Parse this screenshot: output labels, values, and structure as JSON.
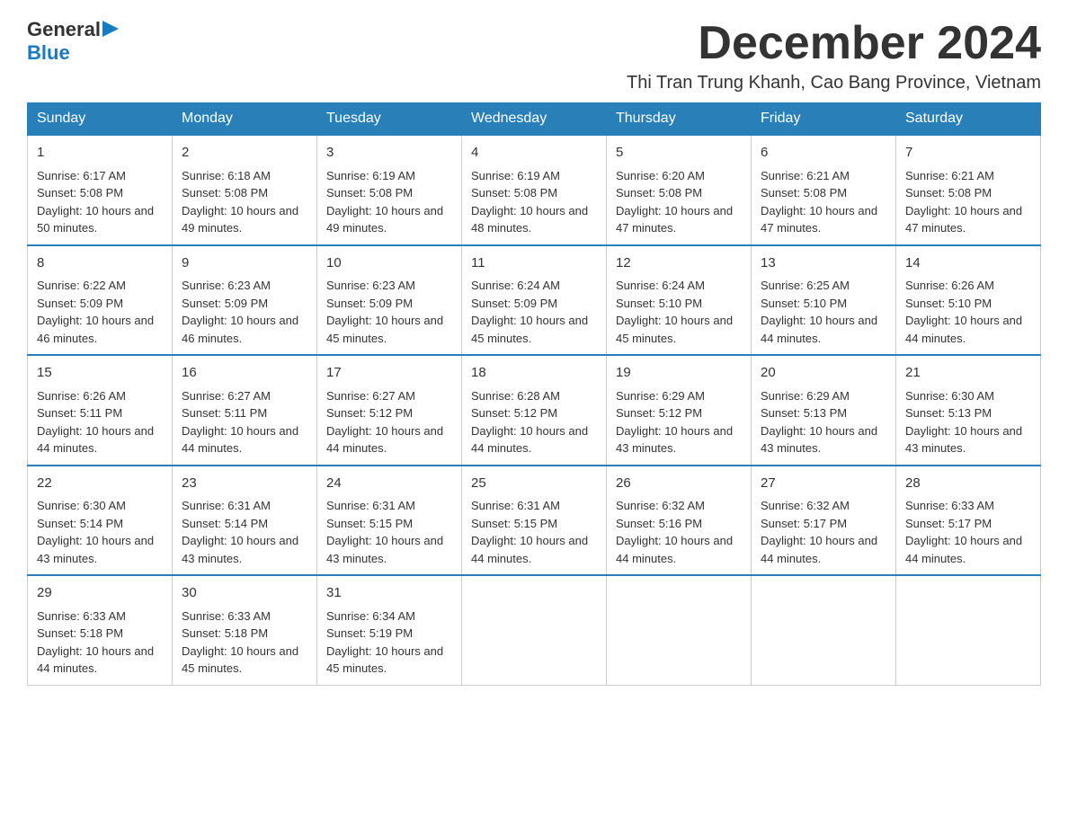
{
  "header": {
    "logo_general": "General",
    "logo_blue": "Blue",
    "month_title": "December 2024",
    "location": "Thi Tran Trung Khanh, Cao Bang Province, Vietnam"
  },
  "weekdays": [
    "Sunday",
    "Monday",
    "Tuesday",
    "Wednesday",
    "Thursday",
    "Friday",
    "Saturday"
  ],
  "weeks": [
    [
      {
        "day": "1",
        "sunrise": "Sunrise: 6:17 AM",
        "sunset": "Sunset: 5:08 PM",
        "daylight": "Daylight: 10 hours and 50 minutes."
      },
      {
        "day": "2",
        "sunrise": "Sunrise: 6:18 AM",
        "sunset": "Sunset: 5:08 PM",
        "daylight": "Daylight: 10 hours and 49 minutes."
      },
      {
        "day": "3",
        "sunrise": "Sunrise: 6:19 AM",
        "sunset": "Sunset: 5:08 PM",
        "daylight": "Daylight: 10 hours and 49 minutes."
      },
      {
        "day": "4",
        "sunrise": "Sunrise: 6:19 AM",
        "sunset": "Sunset: 5:08 PM",
        "daylight": "Daylight: 10 hours and 48 minutes."
      },
      {
        "day": "5",
        "sunrise": "Sunrise: 6:20 AM",
        "sunset": "Sunset: 5:08 PM",
        "daylight": "Daylight: 10 hours and 47 minutes."
      },
      {
        "day": "6",
        "sunrise": "Sunrise: 6:21 AM",
        "sunset": "Sunset: 5:08 PM",
        "daylight": "Daylight: 10 hours and 47 minutes."
      },
      {
        "day": "7",
        "sunrise": "Sunrise: 6:21 AM",
        "sunset": "Sunset: 5:08 PM",
        "daylight": "Daylight: 10 hours and 47 minutes."
      }
    ],
    [
      {
        "day": "8",
        "sunrise": "Sunrise: 6:22 AM",
        "sunset": "Sunset: 5:09 PM",
        "daylight": "Daylight: 10 hours and 46 minutes."
      },
      {
        "day": "9",
        "sunrise": "Sunrise: 6:23 AM",
        "sunset": "Sunset: 5:09 PM",
        "daylight": "Daylight: 10 hours and 46 minutes."
      },
      {
        "day": "10",
        "sunrise": "Sunrise: 6:23 AM",
        "sunset": "Sunset: 5:09 PM",
        "daylight": "Daylight: 10 hours and 45 minutes."
      },
      {
        "day": "11",
        "sunrise": "Sunrise: 6:24 AM",
        "sunset": "Sunset: 5:09 PM",
        "daylight": "Daylight: 10 hours and 45 minutes."
      },
      {
        "day": "12",
        "sunrise": "Sunrise: 6:24 AM",
        "sunset": "Sunset: 5:10 PM",
        "daylight": "Daylight: 10 hours and 45 minutes."
      },
      {
        "day": "13",
        "sunrise": "Sunrise: 6:25 AM",
        "sunset": "Sunset: 5:10 PM",
        "daylight": "Daylight: 10 hours and 44 minutes."
      },
      {
        "day": "14",
        "sunrise": "Sunrise: 6:26 AM",
        "sunset": "Sunset: 5:10 PM",
        "daylight": "Daylight: 10 hours and 44 minutes."
      }
    ],
    [
      {
        "day": "15",
        "sunrise": "Sunrise: 6:26 AM",
        "sunset": "Sunset: 5:11 PM",
        "daylight": "Daylight: 10 hours and 44 minutes."
      },
      {
        "day": "16",
        "sunrise": "Sunrise: 6:27 AM",
        "sunset": "Sunset: 5:11 PM",
        "daylight": "Daylight: 10 hours and 44 minutes."
      },
      {
        "day": "17",
        "sunrise": "Sunrise: 6:27 AM",
        "sunset": "Sunset: 5:12 PM",
        "daylight": "Daylight: 10 hours and 44 minutes."
      },
      {
        "day": "18",
        "sunrise": "Sunrise: 6:28 AM",
        "sunset": "Sunset: 5:12 PM",
        "daylight": "Daylight: 10 hours and 44 minutes."
      },
      {
        "day": "19",
        "sunrise": "Sunrise: 6:29 AM",
        "sunset": "Sunset: 5:12 PM",
        "daylight": "Daylight: 10 hours and 43 minutes."
      },
      {
        "day": "20",
        "sunrise": "Sunrise: 6:29 AM",
        "sunset": "Sunset: 5:13 PM",
        "daylight": "Daylight: 10 hours and 43 minutes."
      },
      {
        "day": "21",
        "sunrise": "Sunrise: 6:30 AM",
        "sunset": "Sunset: 5:13 PM",
        "daylight": "Daylight: 10 hours and 43 minutes."
      }
    ],
    [
      {
        "day": "22",
        "sunrise": "Sunrise: 6:30 AM",
        "sunset": "Sunset: 5:14 PM",
        "daylight": "Daylight: 10 hours and 43 minutes."
      },
      {
        "day": "23",
        "sunrise": "Sunrise: 6:31 AM",
        "sunset": "Sunset: 5:14 PM",
        "daylight": "Daylight: 10 hours and 43 minutes."
      },
      {
        "day": "24",
        "sunrise": "Sunrise: 6:31 AM",
        "sunset": "Sunset: 5:15 PM",
        "daylight": "Daylight: 10 hours and 43 minutes."
      },
      {
        "day": "25",
        "sunrise": "Sunrise: 6:31 AM",
        "sunset": "Sunset: 5:15 PM",
        "daylight": "Daylight: 10 hours and 44 minutes."
      },
      {
        "day": "26",
        "sunrise": "Sunrise: 6:32 AM",
        "sunset": "Sunset: 5:16 PM",
        "daylight": "Daylight: 10 hours and 44 minutes."
      },
      {
        "day": "27",
        "sunrise": "Sunrise: 6:32 AM",
        "sunset": "Sunset: 5:17 PM",
        "daylight": "Daylight: 10 hours and 44 minutes."
      },
      {
        "day": "28",
        "sunrise": "Sunrise: 6:33 AM",
        "sunset": "Sunset: 5:17 PM",
        "daylight": "Daylight: 10 hours and 44 minutes."
      }
    ],
    [
      {
        "day": "29",
        "sunrise": "Sunrise: 6:33 AM",
        "sunset": "Sunset: 5:18 PM",
        "daylight": "Daylight: 10 hours and 44 minutes."
      },
      {
        "day": "30",
        "sunrise": "Sunrise: 6:33 AM",
        "sunset": "Sunset: 5:18 PM",
        "daylight": "Daylight: 10 hours and 45 minutes."
      },
      {
        "day": "31",
        "sunrise": "Sunrise: 6:34 AM",
        "sunset": "Sunset: 5:19 PM",
        "daylight": "Daylight: 10 hours and 45 minutes."
      },
      null,
      null,
      null,
      null
    ]
  ]
}
